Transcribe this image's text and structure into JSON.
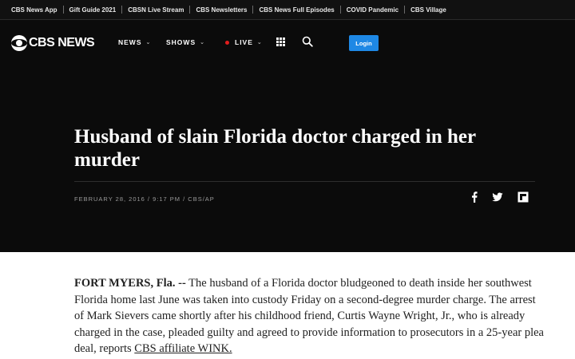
{
  "topbar": {
    "links": [
      "CBS News App",
      "Gift Guide 2021",
      "CBSN Live Stream",
      "CBS Newsletters",
      "CBS News Full Episodes",
      "COVID Pandemic",
      "CBS Village"
    ]
  },
  "nav": {
    "logo_text": "CBS NEWS",
    "items": [
      {
        "label": "NEWS",
        "icon": "chevron-down"
      },
      {
        "label": "SHOWS",
        "icon": "chevron-down"
      },
      {
        "label": "LIVE",
        "icon": "chevron-down"
      }
    ],
    "login_label": "Login",
    "colors": {
      "login": "#1e88e5",
      "live_dot": "#e11d1d",
      "background": "#0b0b0b"
    }
  },
  "article": {
    "headline": "Husband of slain Florida doctor charged in her murder",
    "dateline": "FEBRUARY 28, 2016 / 9:17 PM / CBS/AP",
    "share_icons": [
      "facebook-icon",
      "twitter-icon",
      "flipboard-icon"
    ],
    "body": {
      "place": "FORT MYERS, Fla. --",
      "text": " The husband of a Florida doctor bludgeoned to death inside her southwest Florida home last June was taken into custody Friday on a second-degree murder charge. The arrest of Mark Sievers came shortly after his childhood friend, Curtis Wayne Wright, Jr., who is already charged in the case, pleaded guilty and agreed to provide information to prosecutors in a 25-year plea deal, reports ",
      "link_text": "CBS affiliate WINK."
    }
  }
}
